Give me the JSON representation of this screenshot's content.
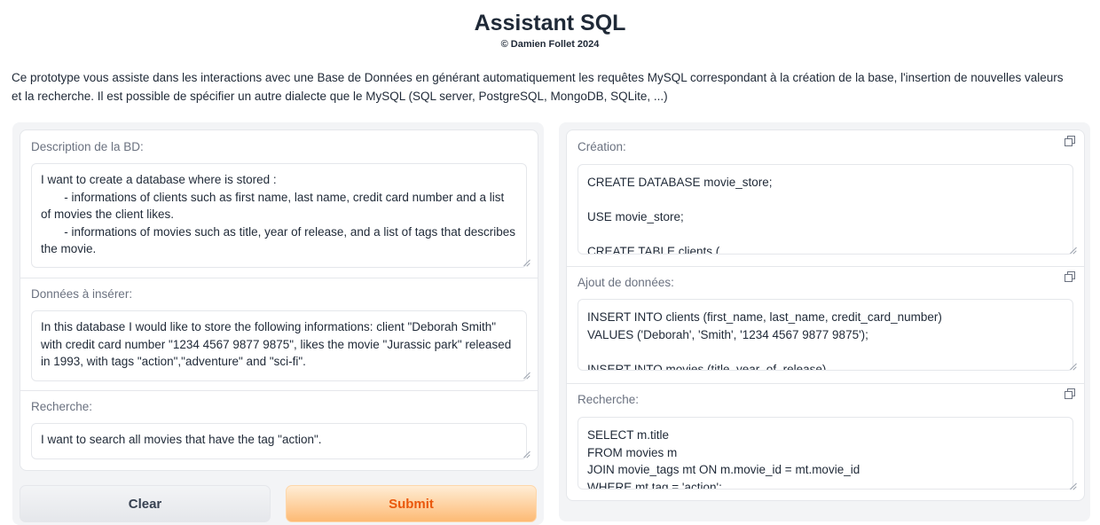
{
  "header": {
    "title": "Assistant SQL",
    "subtitle": "© Damien Follet 2024",
    "intro": "Ce prototype vous assiste dans les interactions avec une Base de Données en générant automatiquement les requêtes MySQL correspondant à la création de la base, l'insertion de nouvelles valeurs et la recherche. Il est possible de spécifier un autre dialecte que le MySQL (SQL server, PostgreSQL, MongoDB, SQLite, ...)"
  },
  "inputs": {
    "description": {
      "label": "Description de la BD:",
      "value": "I want to create a database where is stored :\n       - informations of clients such as first name, last name, credit card number and a list of movies the client likes.\n       - informations of movies such as title, year of release, and a list of tags that describes the movie."
    },
    "data": {
      "label": "Données à insérer:",
      "value": "In this database I would like to store the following informations: client \"Deborah Smith\" with credit card number \"1234 4567 9877 9875\", likes the movie \"Jurassic park\" released in 1993, with tags \"action\",\"adventure\" and \"sci-fi\"."
    },
    "search": {
      "label": "Recherche:",
      "value": "I want to search all movies that have the tag \"action\"."
    }
  },
  "buttons": {
    "clear": "Clear",
    "submit": "Submit"
  },
  "outputs": {
    "creation": {
      "label": "Création:",
      "value": "CREATE DATABASE movie_store;\n\nUSE movie_store;\n\nCREATE TABLE clients ("
    },
    "insert": {
      "label": "Ajout de données:",
      "value": "INSERT INTO clients (first_name, last_name, credit_card_number)\nVALUES ('Deborah', 'Smith', '1234 4567 9877 9875');\n\nINSERT INTO movies (title, year_of_release)"
    },
    "search": {
      "label": "Recherche:",
      "value": "SELECT m.title\nFROM movies m\nJOIN movie_tags mt ON m.movie_id = mt.movie_id\nWHERE mt.tag = 'action';"
    }
  },
  "icons": {
    "copy": "copy-icon"
  },
  "colors": {
    "accent": "#ea580c",
    "submit_bg": "#fdba74",
    "panel_bg": "#f3f4f6"
  }
}
